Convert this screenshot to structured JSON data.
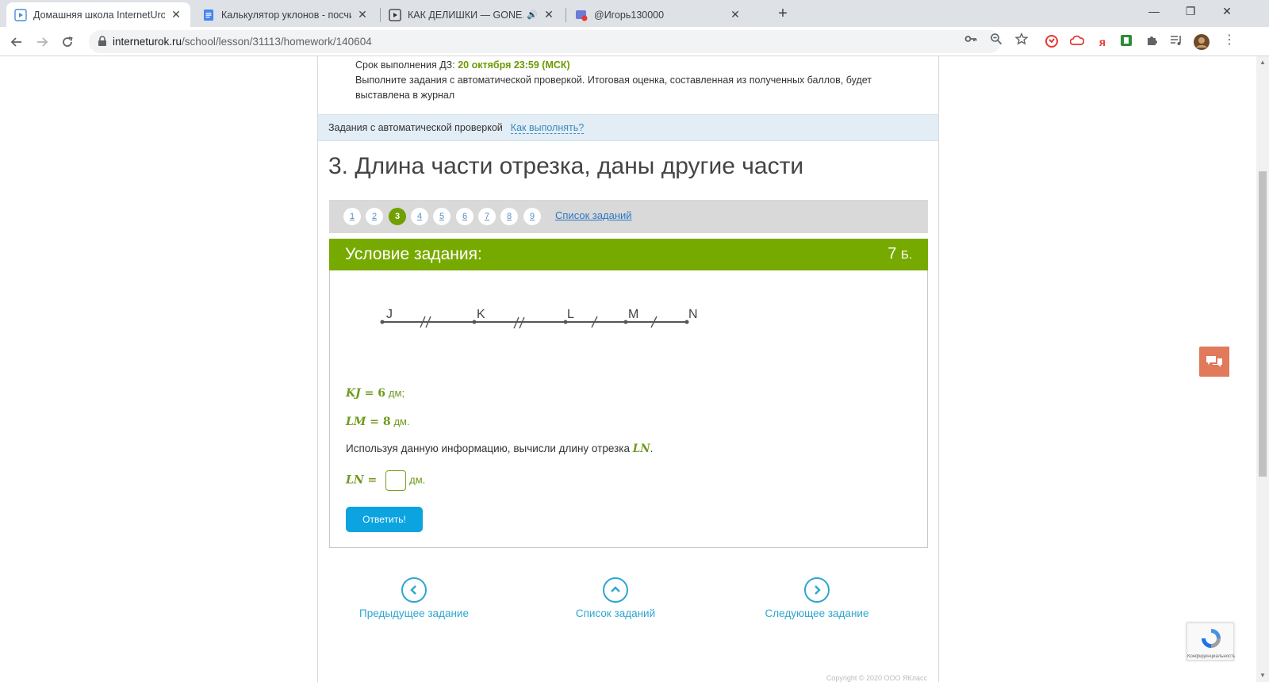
{
  "browser": {
    "tabs": [
      {
        "title": "Домашняя школа InternetUrok.r",
        "icon": "play-doc-icon",
        "active": true
      },
      {
        "title": "Калькулятор уклонов - посчита",
        "icon": "google-docs-icon",
        "active": false
      },
      {
        "title": "КАК ДЕЛИШКИ — GONE.Flu",
        "icon": "play-icon",
        "active": false,
        "audio": "🔊"
      },
      {
        "title": "@Игорь130000",
        "icon": "recording-icon",
        "active": false
      }
    ],
    "tab_close": "✕",
    "new_tab": "+",
    "url_host": "interneturok.ru",
    "url_path": "/school/lesson/31113/homework/140604",
    "window": {
      "minimize": "—",
      "restore": "❐",
      "close": "✕"
    }
  },
  "homework": {
    "deadline_label": "Срок выполнения ДЗ:",
    "deadline_value": "20 октября 23:59 (МСК)",
    "description": "Выполните задания с автоматической проверкой. Итоговая оценка, составленная из полученных баллов, будет выставлена в журнал"
  },
  "autocheck": {
    "label": "Задания с автоматической проверкой",
    "how_link": "Как выполнять?"
  },
  "task": {
    "title": "3. Длина части отрезка, даны другие части",
    "pages": [
      "1",
      "2",
      "3",
      "4",
      "5",
      "6",
      "7",
      "8",
      "9"
    ],
    "current_page": "3",
    "list_link": "Список заданий",
    "condition_label": "Условие задания:",
    "points_value": "7",
    "points_unit": "Б.",
    "segment_points": [
      "J",
      "K",
      "L",
      "M",
      "N"
    ],
    "given": [
      {
        "expr": "KJ = ",
        "value": "6",
        "unit": "дм;"
      },
      {
        "expr": "LM = ",
        "value": "8",
        "unit": "дм."
      }
    ],
    "question_text": "Используя данную информацию, вычисли длину отрезка",
    "question_var": "LN",
    "question_end": ".",
    "answer_expr": "LN = ",
    "answer_unit": "дм.",
    "answer_value": "",
    "submit_label": "Ответить!"
  },
  "navigation": {
    "prev": "Предыдущее задание",
    "list": "Список заданий",
    "next": "Следующее задание"
  },
  "footer": {
    "copyright": "Copyright © 2020 ООО ЯКласс"
  },
  "recaptcha": {
    "text": "Конфиденциальность"
  },
  "colors": {
    "accent_green": "#76aa00",
    "link_blue": "#2ea6cf",
    "button_blue": "#0ba3e0"
  }
}
